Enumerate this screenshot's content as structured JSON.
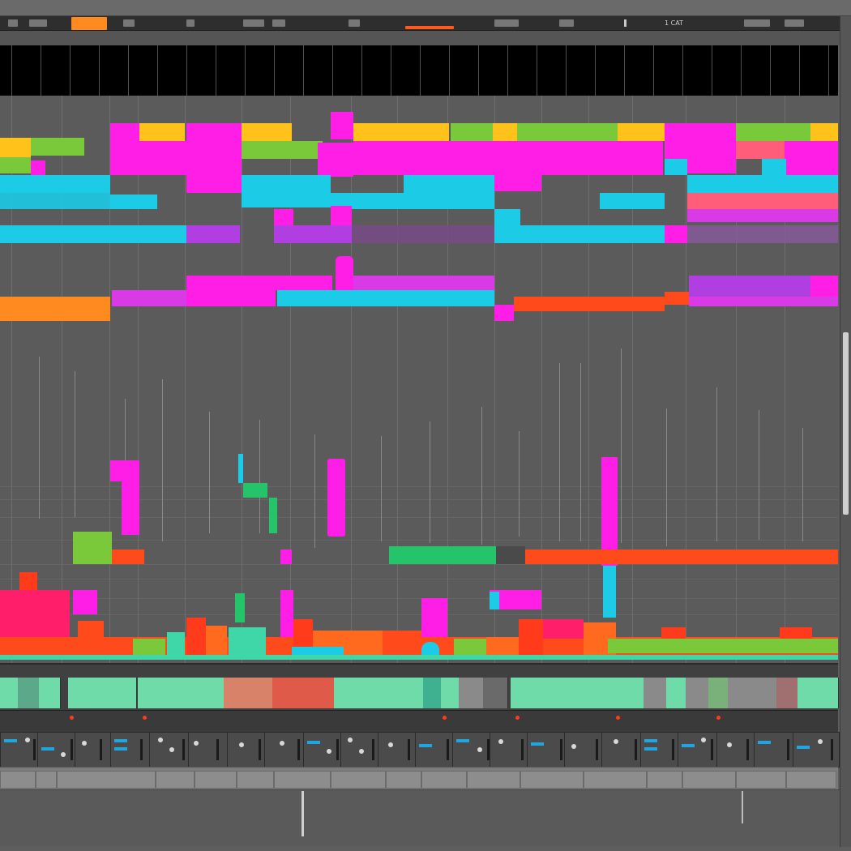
{
  "colors": {
    "magenta": "#ff1ee6",
    "cyan": "#1ccbe6",
    "orange": "#ff8a1f",
    "yellow": "#ffc21a",
    "green": "#79c93a",
    "red": "#ff4a1c",
    "teal": "#3fd6a8",
    "purple": "#b03ee0",
    "salmon": "#ff5d7a",
    "lime_green": "#25c36a",
    "mint": "#6fdba8"
  },
  "transport": {
    "display_text": "1 CAT"
  },
  "icons": [
    "play-icon",
    "record-icon",
    "loop-icon",
    "metronome-icon"
  ]
}
